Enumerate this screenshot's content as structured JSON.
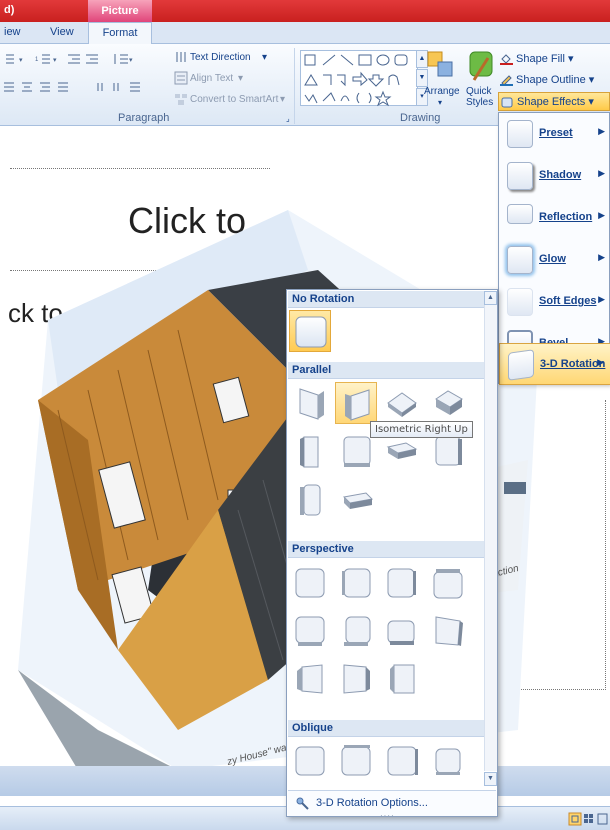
{
  "titlebar": {
    "doc_fragment": "d)",
    "context_tab": "Picture Tools"
  },
  "tabs": {
    "view_fragment": "iew",
    "view": "View",
    "format": "Format"
  },
  "ribbon": {
    "paragraph": {
      "label": "Paragraph",
      "text_direction": "Text Direction",
      "align_text": "Align Text",
      "convert_smartart": "Convert to SmartArt"
    },
    "drawing": {
      "label": "Drawing",
      "arrange": "Arrange",
      "quick_styles_1": "Quick",
      "quick_styles_2": "Styles",
      "shape_fill": "Shape Fill",
      "shape_outline": "Shape Outline",
      "shape_effects": "Shape Effects"
    }
  },
  "slide": {
    "title_placeholder": "Click to",
    "body_placeholder": "ck to a",
    "caption_fragment_1": "zy House\" was",
    "caption_fragment_2": "raction"
  },
  "effects_menu": {
    "items": [
      {
        "label": "Preset"
      },
      {
        "label": "Shadow"
      },
      {
        "label": "Reflection"
      },
      {
        "label": "Glow"
      },
      {
        "label": "Soft Edges"
      },
      {
        "label": "Bevel"
      },
      {
        "label": "3-D Rotation"
      }
    ]
  },
  "rotation_gallery": {
    "sections": {
      "no_rotation": "No Rotation",
      "parallel": "Parallel",
      "perspective": "Perspective",
      "oblique": "Oblique"
    },
    "tooltip": "Isometric Right Up",
    "options": "3-D Rotation Options..."
  },
  "colors": {
    "accent_red": "#c9201f",
    "picture_tools_pink": "#e0457a",
    "highlight": "#ffcb52",
    "ribbon_text": "#15428b"
  }
}
